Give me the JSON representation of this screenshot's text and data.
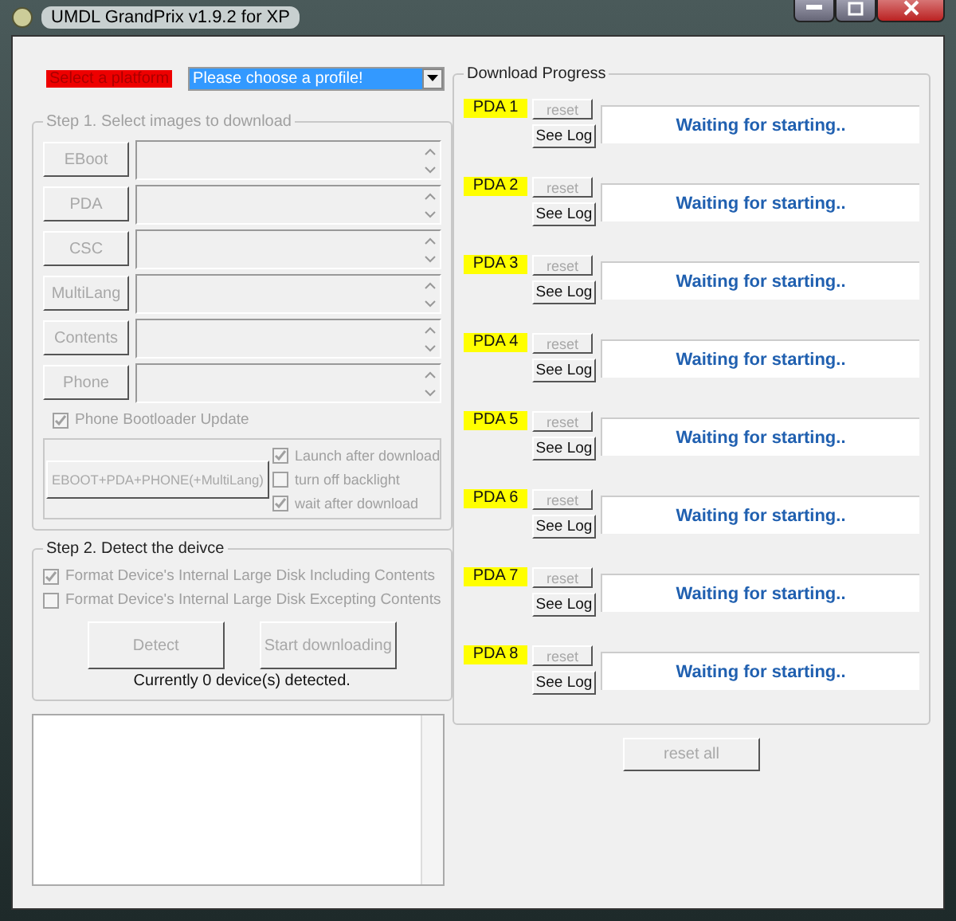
{
  "window": {
    "title": "UMDL GrandPrix v1.9.2 for XP"
  },
  "platform": {
    "label": "Select a platform",
    "profile": "Please choose a profile!"
  },
  "step1": {
    "title": "Step 1. Select images to download",
    "files": [
      {
        "label": "EBoot",
        "disabled": true
      },
      {
        "label": "PDA",
        "disabled": true
      },
      {
        "label": "CSC",
        "disabled": true
      },
      {
        "label": "MultiLang",
        "disabled": true
      },
      {
        "label": "Contents",
        "disabled": true
      },
      {
        "label": "Phone",
        "disabled": true
      }
    ],
    "bootloader": {
      "label": "Phone Bootloader Update",
      "checked": true,
      "disabled": true
    },
    "combo_button": {
      "label": "EBOOT+PDA+PHONE(+MultiLang)",
      "disabled": true
    },
    "options": [
      {
        "label": "Launch after download",
        "checked": true,
        "disabled": true
      },
      {
        "label": "turn off backlight",
        "checked": false,
        "disabled": true
      },
      {
        "label": "wait after download",
        "checked": true,
        "disabled": true
      }
    ]
  },
  "step2": {
    "title": "Step 2. Detect the deivce",
    "options": [
      {
        "label": "Format Device's Internal Large Disk Including Contents",
        "checked": true,
        "disabled": true
      },
      {
        "label": "Format Device's Internal Large Disk Excepting Contents",
        "checked": false,
        "disabled": true
      }
    ],
    "buttons": [
      {
        "label": "Detect",
        "disabled": true
      },
      {
        "label": "Start downloading",
        "disabled": true
      }
    ],
    "status": "Currently 0 device(s) detected."
  },
  "progress": {
    "title": "Download Progress",
    "slots": [
      {
        "label": "PDA 1",
        "reset": "reset",
        "log": "See Log",
        "status": "Waiting for starting.."
      },
      {
        "label": "PDA 2",
        "reset": "reset",
        "log": "See Log",
        "status": "Waiting for starting.."
      },
      {
        "label": "PDA 3",
        "reset": "reset",
        "log": "See Log",
        "status": "Waiting for starting.."
      },
      {
        "label": "PDA 4",
        "reset": "reset",
        "log": "See Log",
        "status": "Waiting for starting.."
      },
      {
        "label": "PDA 5",
        "reset": "reset",
        "log": "See Log",
        "status": "Waiting for starting.."
      },
      {
        "label": "PDA 6",
        "reset": "reset",
        "log": "See Log",
        "status": "Waiting for starting.."
      },
      {
        "label": "PDA 7",
        "reset": "reset",
        "log": "See Log",
        "status": "Waiting for starting.."
      },
      {
        "label": "PDA 8",
        "reset": "reset",
        "log": "See Log",
        "status": "Waiting for starting.."
      }
    ],
    "reset_all": {
      "label": "reset all",
      "disabled": true
    }
  }
}
